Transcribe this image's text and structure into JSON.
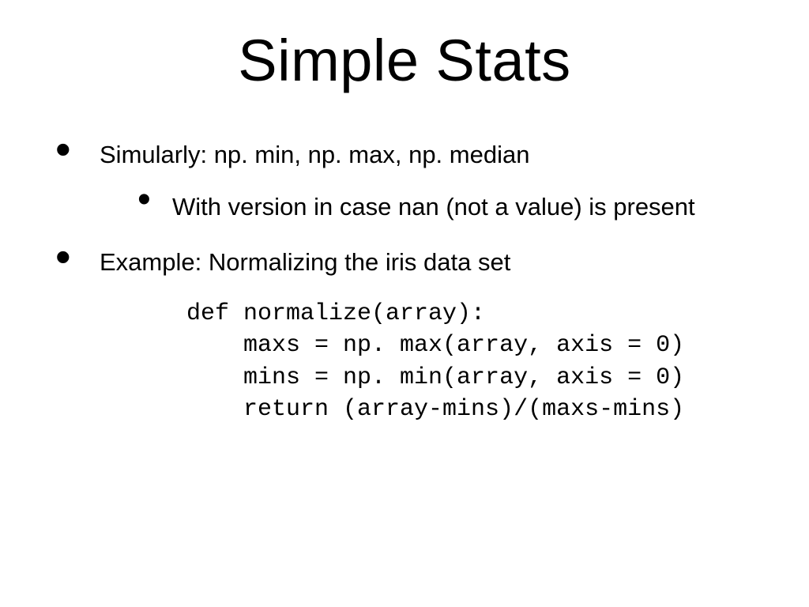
{
  "title": "Simple Stats",
  "bullets": {
    "b1": "Simularly: np. min, np. max, np. median",
    "b1_sub1": "With version in case nan (not a value) is present",
    "b2": "Example: Normalizing the iris data set"
  },
  "code": "def normalize(array):\n    maxs = np. max(array, axis = 0)\n    mins = np. min(array, axis = 0)\n    return (array-mins)/(maxs-mins)"
}
